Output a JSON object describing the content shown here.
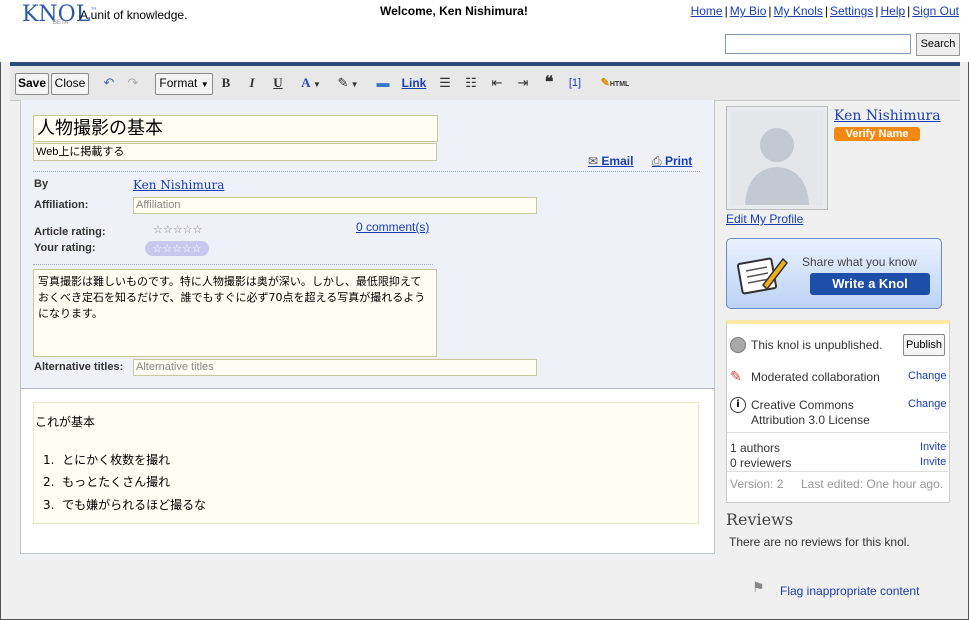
{
  "header": {
    "logo": "KNOL",
    "logo_tm": "™",
    "beta": "BETA",
    "tagline": "A unit of knowledge.",
    "welcome": "Welcome, Ken Nishimura!",
    "links": [
      "Home",
      "My Bio",
      "My Knols",
      "Settings",
      "Help",
      "Sign Out"
    ],
    "search_button": "Search",
    "search_value": ""
  },
  "toolbar": {
    "save": "Save",
    "close": "Close",
    "format": "Format",
    "bold": "B",
    "italic": "I",
    "underline": "U",
    "font_color": "A",
    "link": "Link",
    "footnote": "[1]",
    "html": "HTML"
  },
  "knol": {
    "title": "人物撮影の基本",
    "subtitle": "Web上に掲載する",
    "email": "Email",
    "print": "Print",
    "by_label": "By",
    "author": "Ken Nishimura",
    "affiliation_label": "Affiliation:",
    "affiliation_placeholder": "Affiliation",
    "article_rating_label": "Article rating:",
    "your_rating_label": "Your rating:",
    "stars": "☆☆☆☆☆",
    "comments": "0 comment(s)",
    "summary": "写真撮影は難しいものです。特に人物撮影は奥が深い。しかし、最低限抑えておくべき定石を知るだけで、誰でもすぐに必ず70点を超える写真が撮れるようになります。",
    "alt_titles_label": "Alternative titles:",
    "alt_titles_placeholder": "Alternative titles",
    "body_heading": "これが基本",
    "body_items": [
      "とにかく枚数を撮れ",
      "もっとたくさん撮れ",
      "でも嫌がられるほど撮るな"
    ]
  },
  "sidebar": {
    "profile_name": "Ken Nishimura",
    "verify_name": "Verify Name",
    "edit_profile": "Edit My Profile",
    "share_text": "Share what you know",
    "write_knol": "Write a Knol",
    "unpublished": "This knol is unpublished.",
    "publish": "Publish",
    "moderated": "Moderated collaboration",
    "change": "Change",
    "license_line1": "Creative Commons",
    "license_line2": "Attribution 3.0 License",
    "authors": "1 authors",
    "reviewers": "0 reviewers",
    "invite": "Invite",
    "version": "Version: 2",
    "last_edited": "Last edited: One hour ago.",
    "reviews_heading": "Reviews",
    "reviews_text": "There are no reviews for this knol.",
    "flag": "Flag inappropriate content"
  },
  "colors": {
    "link": "#1a3eb0",
    "header_bar": "#2b4a7e",
    "verify": "#f08a14",
    "write_button": "#1f4ea8",
    "field_bg": "#fefef2"
  }
}
